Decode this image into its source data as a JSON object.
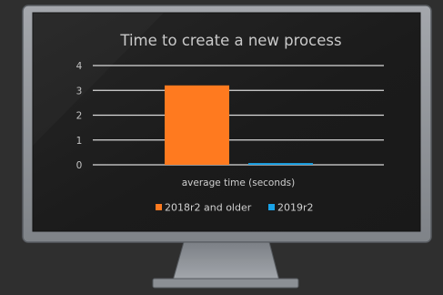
{
  "chart_data": {
    "type": "bar",
    "title": "Time to create a new process",
    "categories": [
      "average time (seconds)"
    ],
    "xlabel": "average time (seconds)",
    "ylabel": "",
    "ylim": [
      0,
      4
    ],
    "yticks": [
      "0",
      "1",
      "2",
      "3",
      "4"
    ],
    "grid": true,
    "legend_position": "bottom",
    "series": [
      {
        "name": "2018r2 and older",
        "values": [
          3.2
        ],
        "color": "#ff7a1f"
      },
      {
        "name": "2019r2",
        "values": [
          0.07
        ],
        "color": "#1aa3e8"
      }
    ]
  },
  "colors": {
    "background": "#2f2f2f",
    "monitor_frame": "#8e9298",
    "screen": "#1e1e1e",
    "grid": "#d9d9d9",
    "text": "#d0d0d0"
  },
  "icons": [
    "monitor-frame-icon",
    "monitor-stand-icon",
    "legend-swatch-icon"
  ]
}
